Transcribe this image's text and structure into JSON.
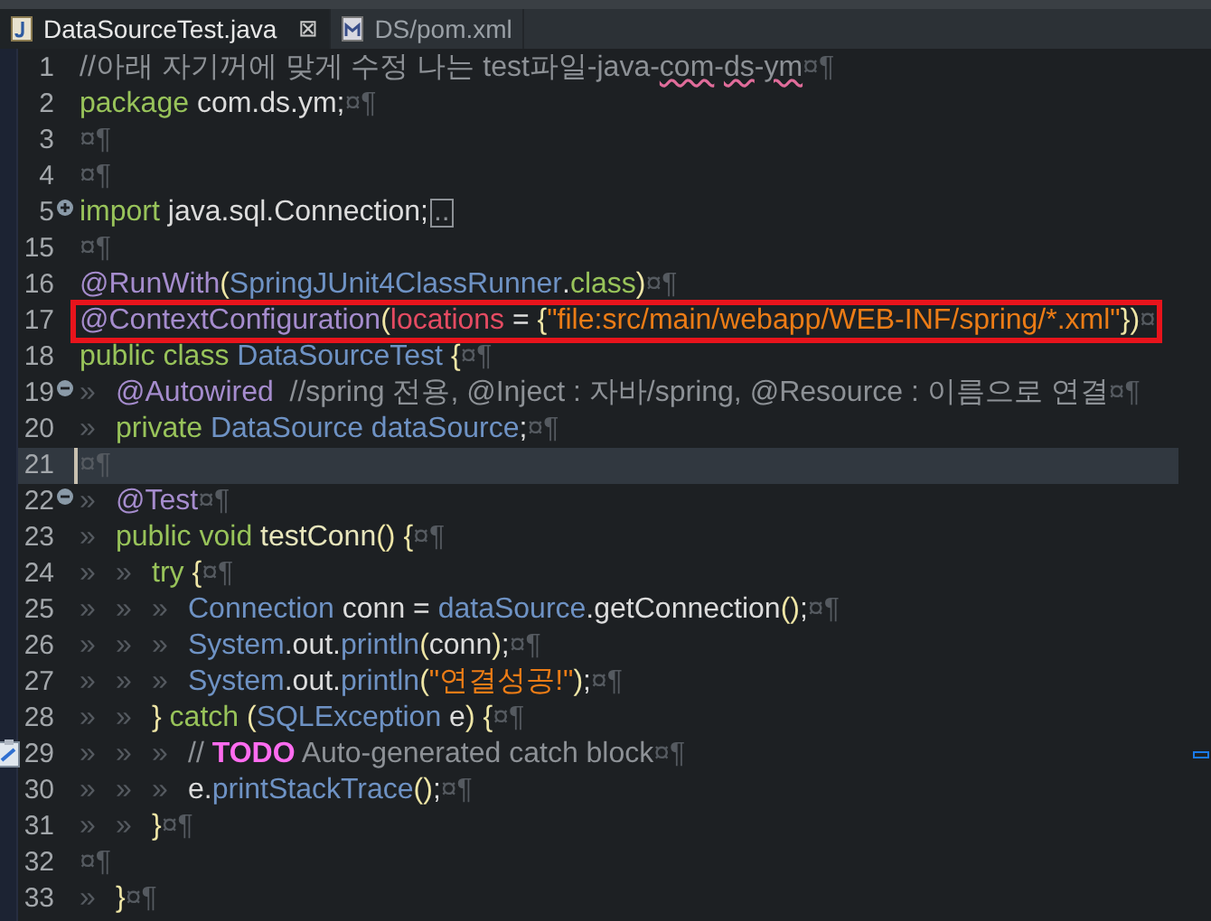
{
  "tabs": [
    {
      "label": "DataSourceTest.java",
      "kind": "java",
      "selected": true,
      "close": "⊠"
    },
    {
      "label": "DS/pom.xml",
      "kind": "maven",
      "selected": false
    }
  ],
  "editor": {
    "lines": [
      {
        "number": "1",
        "current": false,
        "boxed": false,
        "tokens": [
          {
            "kind": "cmt",
            "text": "//아래 자기꺼에 맞게 수정 나는 test파일-java-"
          },
          {
            "kind": "typo",
            "text": "com"
          },
          {
            "kind": "cmt",
            "text": "-"
          },
          {
            "kind": "typo",
            "text": "ds"
          },
          {
            "kind": "cmt",
            "text": "-"
          },
          {
            "kind": "typo",
            "text": "ym"
          },
          {
            "kind": "ws",
            "text": "¤¶"
          }
        ]
      },
      {
        "number": "2",
        "current": false,
        "boxed": false,
        "tokens": [
          {
            "kind": "kw",
            "text": "package"
          },
          {
            "kind": "plain",
            "text": " com.ds.ym;"
          },
          {
            "kind": "ws",
            "text": "¤¶"
          }
        ]
      },
      {
        "number": "3",
        "current": false,
        "boxed": false,
        "tokens": [
          {
            "kind": "ws",
            "text": "¤¶"
          }
        ]
      },
      {
        "number": "4",
        "current": false,
        "boxed": false,
        "tokens": [
          {
            "kind": "ws",
            "text": "¤¶"
          }
        ]
      },
      {
        "number": "5",
        "fold": {
          "kind": "expand"
        },
        "current": false,
        "boxed": false,
        "tokens": [
          {
            "kind": "kw",
            "text": "import"
          },
          {
            "kind": "plain",
            "text": " java.sql.Connection;"
          },
          {
            "kind": "folded",
            "text": ".."
          }
        ]
      },
      {
        "number": "15",
        "current": false,
        "boxed": false,
        "tokens": [
          {
            "kind": "ws",
            "text": "¤¶"
          }
        ]
      },
      {
        "number": "16",
        "current": false,
        "boxed": false,
        "tokens": [
          {
            "kind": "ann",
            "text": "@RunWith"
          },
          {
            "kind": "brace",
            "text": "("
          },
          {
            "kind": "type",
            "text": "SpringJUnit4ClassRunner"
          },
          {
            "kind": "plain",
            "text": "."
          },
          {
            "kind": "kw",
            "text": "class"
          },
          {
            "kind": "brace",
            "text": ")"
          },
          {
            "kind": "ws",
            "text": "¤¶"
          }
        ]
      },
      {
        "number": "17",
        "current": false,
        "boxed": true,
        "tokens": [
          {
            "kind": "ann",
            "text": "@ContextConfiguration"
          },
          {
            "kind": "brace",
            "text": "("
          },
          {
            "kind": "field",
            "text": "locations"
          },
          {
            "kind": "plain",
            "text": " = "
          },
          {
            "kind": "brace",
            "text": "{"
          },
          {
            "kind": "str",
            "text": "\"file:src/main/webapp/WEB-INF/spring/*.xml\""
          },
          {
            "kind": "brace",
            "text": "})"
          },
          {
            "kind": "ws",
            "text": "¤"
          }
        ]
      },
      {
        "number": "18",
        "current": false,
        "boxed": false,
        "tokens": [
          {
            "kind": "kw",
            "text": "public class"
          },
          {
            "kind": "type",
            "text": " DataSourceTest "
          },
          {
            "kind": "brace",
            "text": "{"
          },
          {
            "kind": "ws",
            "text": "¤¶"
          }
        ]
      },
      {
        "number": "19",
        "fold": {
          "kind": "collapse"
        },
        "current": false,
        "boxed": false,
        "tokens": [
          {
            "kind": "tab",
            "text": "»"
          },
          {
            "kind": "ann",
            "text": "@Autowired"
          },
          {
            "kind": "cmt",
            "text": "  //spring 전용, @Inject : 자바/spring, @Resource : 이름으로 연결"
          },
          {
            "kind": "ws",
            "text": "¤¶"
          }
        ]
      },
      {
        "number": "20",
        "current": false,
        "boxed": false,
        "tokens": [
          {
            "kind": "tab",
            "text": "»"
          },
          {
            "kind": "kw",
            "text": "private"
          },
          {
            "kind": "type",
            "text": " DataSource dataSource"
          },
          {
            "kind": "plain",
            "text": ";"
          },
          {
            "kind": "ws",
            "text": "¤¶"
          }
        ]
      },
      {
        "number": "21",
        "current": true,
        "boxed": false,
        "tokens": [
          {
            "kind": "ws",
            "text": "¤¶"
          }
        ]
      },
      {
        "number": "22",
        "fold": {
          "kind": "collapse"
        },
        "current": false,
        "boxed": false,
        "tokens": [
          {
            "kind": "tab",
            "text": "»"
          },
          {
            "kind": "ann",
            "text": "@Test"
          },
          {
            "kind": "ws",
            "text": "¤¶"
          }
        ]
      },
      {
        "number": "23",
        "current": false,
        "boxed": false,
        "tokens": [
          {
            "kind": "tab",
            "text": "»"
          },
          {
            "kind": "kw",
            "text": "public void"
          },
          {
            "kind": "method",
            "text": " testConn"
          },
          {
            "kind": "brace",
            "text": "() {"
          },
          {
            "kind": "ws",
            "text": "¤¶"
          }
        ]
      },
      {
        "number": "24",
        "current": false,
        "boxed": false,
        "tokens": [
          {
            "kind": "tab",
            "text": "»"
          },
          {
            "kind": "tab",
            "text": "»"
          },
          {
            "kind": "kw",
            "text": "try"
          },
          {
            "kind": "brace",
            "text": " {"
          },
          {
            "kind": "ws",
            "text": "¤¶"
          }
        ]
      },
      {
        "number": "25",
        "current": false,
        "boxed": false,
        "tokens": [
          {
            "kind": "tab",
            "text": "»"
          },
          {
            "kind": "tab",
            "text": "»"
          },
          {
            "kind": "tab",
            "text": "»"
          },
          {
            "kind": "type",
            "text": "Connection"
          },
          {
            "kind": "plain",
            "text": " conn = "
          },
          {
            "kind": "type",
            "text": "dataSource"
          },
          {
            "kind": "plain",
            "text": ".getConnection"
          },
          {
            "kind": "brace",
            "text": "()"
          },
          {
            "kind": "plain",
            "text": ";"
          },
          {
            "kind": "ws",
            "text": "¤¶"
          }
        ]
      },
      {
        "number": "26",
        "current": false,
        "boxed": false,
        "tokens": [
          {
            "kind": "tab",
            "text": "»"
          },
          {
            "kind": "tab",
            "text": "»"
          },
          {
            "kind": "tab",
            "text": "»"
          },
          {
            "kind": "type",
            "text": "System"
          },
          {
            "kind": "plain",
            "text": ".out."
          },
          {
            "kind": "type",
            "text": "println"
          },
          {
            "kind": "brace",
            "text": "("
          },
          {
            "kind": "plain",
            "text": "conn"
          },
          {
            "kind": "brace",
            "text": ")"
          },
          {
            "kind": "plain",
            "text": ";"
          },
          {
            "kind": "ws",
            "text": "¤¶"
          }
        ]
      },
      {
        "number": "27",
        "current": false,
        "boxed": false,
        "tokens": [
          {
            "kind": "tab",
            "text": "»"
          },
          {
            "kind": "tab",
            "text": "»"
          },
          {
            "kind": "tab",
            "text": "»"
          },
          {
            "kind": "type",
            "text": "System"
          },
          {
            "kind": "plain",
            "text": ".out."
          },
          {
            "kind": "type",
            "text": "println"
          },
          {
            "kind": "brace",
            "text": "("
          },
          {
            "kind": "str",
            "text": "\"연결성공!\""
          },
          {
            "kind": "brace",
            "text": ")"
          },
          {
            "kind": "plain",
            "text": ";"
          },
          {
            "kind": "ws",
            "text": "¤¶"
          }
        ]
      },
      {
        "number": "28",
        "current": false,
        "boxed": false,
        "tokens": [
          {
            "kind": "tab",
            "text": "»"
          },
          {
            "kind": "tab",
            "text": "»"
          },
          {
            "kind": "brace",
            "text": "}"
          },
          {
            "kind": "kw",
            "text": " catch "
          },
          {
            "kind": "brace",
            "text": "("
          },
          {
            "kind": "type",
            "text": "SQLException"
          },
          {
            "kind": "plain",
            "text": " e"
          },
          {
            "kind": "brace",
            "text": ") {"
          },
          {
            "kind": "ws",
            "text": "¤¶"
          }
        ]
      },
      {
        "number": "29",
        "marker": {
          "kind": "task"
        },
        "current": false,
        "boxed": false,
        "tokens": [
          {
            "kind": "tab",
            "text": "»"
          },
          {
            "kind": "tab",
            "text": "»"
          },
          {
            "kind": "tab",
            "text": "»"
          },
          {
            "kind": "cmt",
            "text": "// "
          },
          {
            "kind": "todo",
            "text": "TODO"
          },
          {
            "kind": "cmt",
            "text": " Auto-generated catch block"
          },
          {
            "kind": "ws",
            "text": "¤¶"
          }
        ]
      },
      {
        "number": "30",
        "current": false,
        "boxed": false,
        "tokens": [
          {
            "kind": "tab",
            "text": "»"
          },
          {
            "kind": "tab",
            "text": "»"
          },
          {
            "kind": "tab",
            "text": "»"
          },
          {
            "kind": "plain",
            "text": "e."
          },
          {
            "kind": "type",
            "text": "printStackTrace"
          },
          {
            "kind": "brace",
            "text": "()"
          },
          {
            "kind": "plain",
            "text": ";"
          },
          {
            "kind": "ws",
            "text": "¤¶"
          }
        ]
      },
      {
        "number": "31",
        "current": false,
        "boxed": false,
        "tokens": [
          {
            "kind": "tab",
            "text": "»"
          },
          {
            "kind": "tab",
            "text": "»"
          },
          {
            "kind": "brace",
            "text": "}"
          },
          {
            "kind": "ws",
            "text": "¤¶"
          }
        ]
      },
      {
        "number": "32",
        "current": false,
        "boxed": false,
        "tokens": [
          {
            "kind": "ws",
            "text": "¤¶"
          }
        ]
      },
      {
        "number": "33",
        "current": false,
        "boxed": false,
        "tokens": [
          {
            "kind": "tab",
            "text": "»"
          },
          {
            "kind": "brace",
            "text": "}"
          },
          {
            "kind": "ws",
            "text": "¤¶"
          }
        ]
      }
    ]
  }
}
